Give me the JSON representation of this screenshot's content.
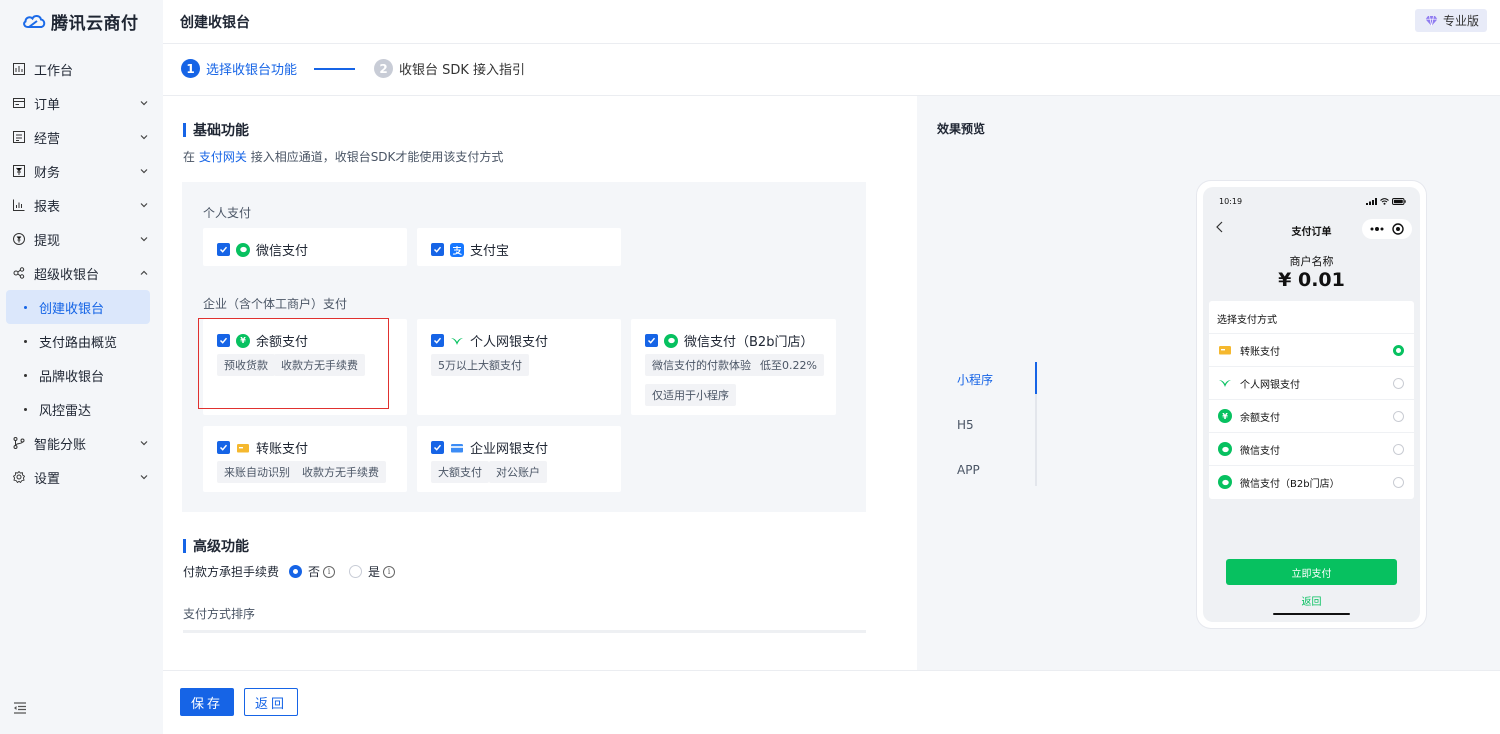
{
  "brand": {
    "name": "腾讯云商付"
  },
  "header": {
    "title": "创建收银台",
    "badge": "专业版"
  },
  "nav": {
    "items": [
      {
        "label": "工作台",
        "icon": "dashboard-icon"
      },
      {
        "label": "订单",
        "icon": "order-icon"
      },
      {
        "label": "经营",
        "icon": "business-icon"
      },
      {
        "label": "财务",
        "icon": "finance-icon"
      },
      {
        "label": "报表",
        "icon": "report-icon"
      },
      {
        "label": "提现",
        "icon": "withdraw-icon"
      },
      {
        "label": "超级收银台",
        "icon": "cashier-icon"
      }
    ],
    "sub": [
      "创建收银台",
      "支付路由概览",
      "品牌收银台",
      "风控雷达"
    ],
    "after": [
      {
        "label": "智能分账",
        "icon": "split-icon"
      },
      {
        "label": "设置",
        "icon": "settings-icon"
      }
    ]
  },
  "steps": [
    {
      "num": "1",
      "label": "选择收银台功能"
    },
    {
      "num": "2",
      "label": "收银台 SDK 接入指引"
    }
  ],
  "basic": {
    "title": "基础功能",
    "desc_prefix": "在",
    "desc_link": "支付网关",
    "desc_suffix": "接入相应通道，收银台SDK才能使用该支付方式",
    "personal_label": "个人支付",
    "personal": [
      {
        "name": "微信支付"
      },
      {
        "name": "支付宝"
      }
    ],
    "enterprise_label": "企业（含个体工商户）支付",
    "enterprise": [
      {
        "name": "余额支付",
        "tags": [
          "预收货款",
          "收款方无手续费"
        ]
      },
      {
        "name": "个人网银支付",
        "tags": [
          "5万以上大额支付"
        ]
      },
      {
        "name": "微信支付（B2b门店）",
        "tags": [
          "微信支付的付款体验",
          "低至0.22%",
          "仅适用于小程序"
        ]
      },
      {
        "name": "转账支付",
        "tags": [
          "来账自动识别",
          "收款方无手续费"
        ]
      },
      {
        "name": "企业网银支付",
        "tags": [
          "大额支付",
          "对公账户"
        ]
      }
    ]
  },
  "advanced": {
    "title": "高级功能",
    "fee_label": "付款方承担手续费",
    "opt_no": "否",
    "opt_yes": "是",
    "selected": "否",
    "sort_label": "支付方式排序"
  },
  "footer": {
    "save": "保存",
    "back": "返回"
  },
  "preview": {
    "title": "效果预览",
    "tabs": [
      "小程序",
      "H5",
      "APP"
    ],
    "active_tab": "小程序",
    "phone": {
      "time": "10:19",
      "nav_title": "支付订单",
      "merchant": "商户名称",
      "amount": "¥ 0.01",
      "choose": "选择支付方式",
      "methods": [
        "转账支付",
        "个人网银支付",
        "余额支付",
        "微信支付",
        "微信支付（B2b门店）"
      ],
      "selected": "转账支付",
      "pay_button": "立即支付",
      "return": "返回"
    }
  },
  "colors": {
    "primary": "#1664e6",
    "wechat": "#07c160",
    "highlight": "#e0312f"
  }
}
